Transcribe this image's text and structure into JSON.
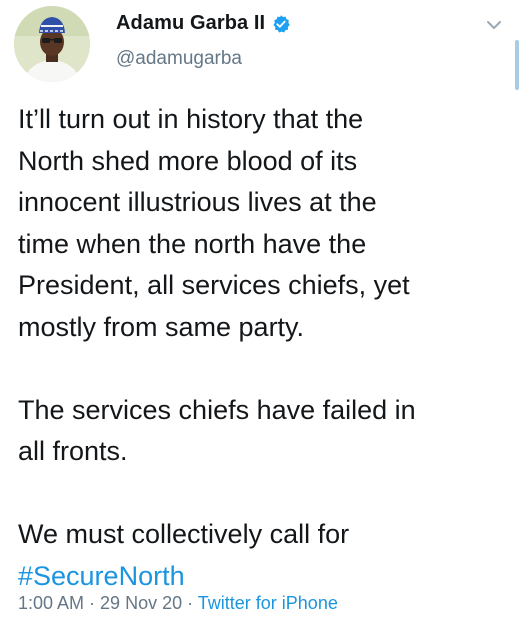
{
  "author": {
    "display_name": "Adamu Garba II",
    "handle": "@adamugarba",
    "verified": true,
    "avatar_icon": "profile-photo"
  },
  "tweet": {
    "paragraphs": [
      "It’ll turn out in history that the\nNorth shed more blood of its\ninnocent illustrious lives at the\ntime when the north have the\nPresident, all services chiefs, yet\nmostly from same party.",
      "The services chiefs have failed in\nall fronts.",
      "We must collectively call for"
    ],
    "hashtag": "#SecureNorth"
  },
  "meta": {
    "time": "1:00 AM",
    "separator1": " · ",
    "date": "29 Nov 20",
    "separator2": " · ",
    "source": "Twitter for iPhone"
  },
  "colors": {
    "link": "#1b95e0",
    "secondary_text": "#657786",
    "primary_text": "#14171a",
    "verified_badge": "#1da1f2"
  },
  "icons": {
    "menu": "chevron-down-icon",
    "badge": "verified-badge-icon"
  }
}
